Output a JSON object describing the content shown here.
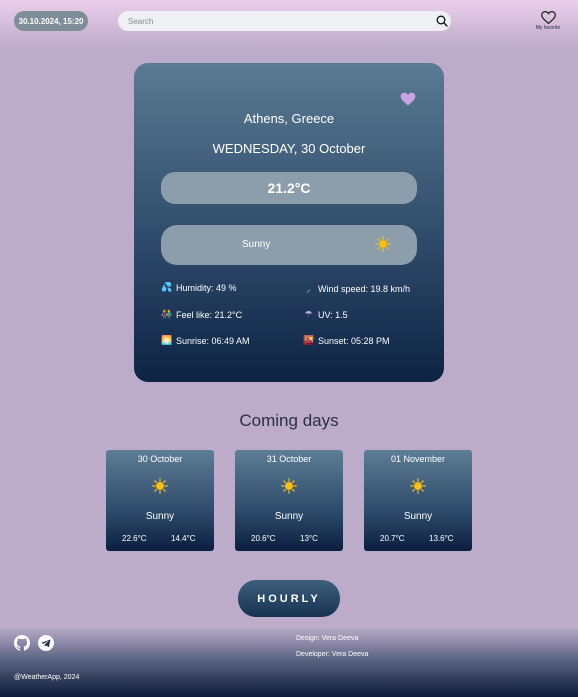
{
  "header": {
    "datetime": "30.10.2024, 15:20",
    "search_placeholder": "Search",
    "favorites_label": "My favorite"
  },
  "current": {
    "city": "Athens, Greece",
    "date": "WEDNESDAY, 30 October",
    "temperature": "21.2°C",
    "condition": "Sunny",
    "condition_icon": "sun-icon",
    "humidity": "Humidity: 49 %",
    "wind": "Wind speed: 19.8 km/h",
    "feels_like": "Feel like: 21.2°C",
    "uv": "UV: 1.5",
    "sunrise": "Sunrise: 06:49 AM",
    "sunset": "Sunset: 05:28 PM"
  },
  "forecast": {
    "title": "Coming days",
    "days": [
      {
        "date": "30 October",
        "condition": "Sunny",
        "max": "22.6°C",
        "min": "14.4°C"
      },
      {
        "date": "31 October",
        "condition": "Sunny",
        "max": "20.6°C",
        "min": "13°C"
      },
      {
        "date": "01 November",
        "condition": "Sunny",
        "max": "20.7°C",
        "min": "13.6°C"
      }
    ]
  },
  "hourly_button": "HOURLY",
  "footer": {
    "design": "Design: Vera Deeva",
    "developer": "Developer: Vera Deeva",
    "copyright": "@WeatherApp, 2024"
  },
  "colors": {
    "background": "#bcabc9",
    "card_top": "#5a7b93",
    "card_bottom": "#0d2344",
    "favorite_heart": "#c8a6e3",
    "sun": "#f6c21a"
  }
}
